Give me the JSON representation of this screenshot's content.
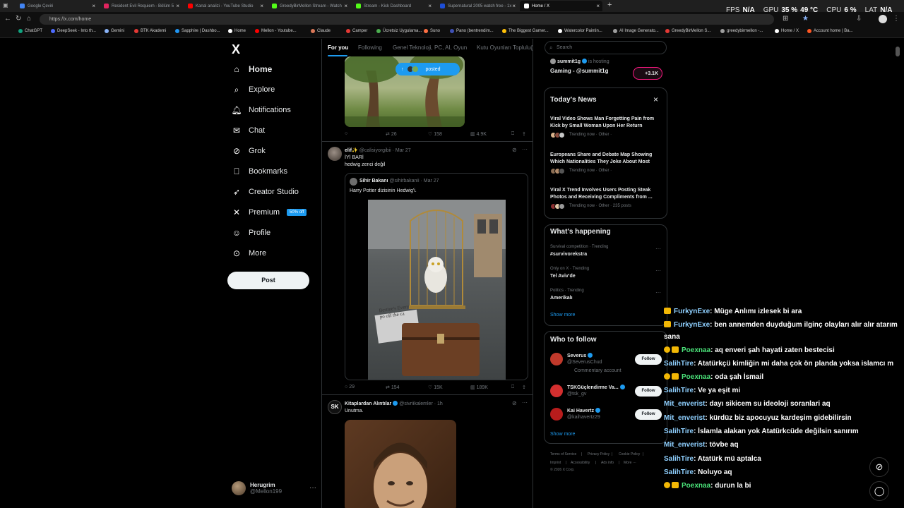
{
  "browser": {
    "tabs": [
      {
        "title": "Google Çeviri",
        "color": "#4285f4"
      },
      {
        "title": "Resident Evil Requiem - Bölüm 5",
        "color": "#e0245e"
      },
      {
        "title": "Kanal analizi - YouTube Studio",
        "color": "#ff0000"
      },
      {
        "title": "GreedyBirMellon Stream - Watch",
        "color": "#53fc18"
      },
      {
        "title": "Stream - Kick Dashboard",
        "color": "#53fc18"
      },
      {
        "title": "Supernatural 2005 watch free - 1x",
        "color": "#1d4ed8"
      },
      {
        "title": "Home / X",
        "color": "#ffffff"
      }
    ],
    "new_tab": "+",
    "url": "https://x.com/home",
    "bookmarks": [
      {
        "label": "ChatGPT",
        "color": "#10a37f"
      },
      {
        "label": "DeepSeek - Into th...",
        "color": "#4d6bfe"
      },
      {
        "label": "Gemini",
        "color": "#8ab4f8"
      },
      {
        "label": "BTK Akademi",
        "color": "#e53935"
      },
      {
        "label": "Sapphire | Dashbo...",
        "color": "#2196f3"
      },
      {
        "label": "Home",
        "color": "#ffffff"
      },
      {
        "label": "Mellon - Youtube...",
        "color": "#ff0000"
      },
      {
        "label": "Claude",
        "color": "#d97757"
      },
      {
        "label": "Camper",
        "color": "#e53935"
      },
      {
        "label": "Ücretsiz Uygulama...",
        "color": "#4caf50"
      },
      {
        "label": "Suno",
        "color": "#ff7043"
      },
      {
        "label": "Pano (bentrendim...",
        "color": "#3f51b5"
      },
      {
        "label": "The Biggest Gamer...",
        "color": "#ffc107"
      },
      {
        "label": "Watercolor Paintin...",
        "color": "#ffffff"
      },
      {
        "label": "AI Image Generato...",
        "color": "#9e9e9e"
      },
      {
        "label": "GreedyBirMellon S...",
        "color": "#e53935"
      },
      {
        "label": "greedybirmellon -...",
        "color": "#9e9e9e"
      },
      {
        "label": "Home / X",
        "color": "#ffffff"
      },
      {
        "label": "Account home | Ba...",
        "color": "#ff5722"
      }
    ],
    "hud": {
      "fps_label": "FPS",
      "fps": "N/A",
      "gpu_label": "GPU",
      "gpu": "35 %",
      "gpu_temp": "49 °C",
      "cpu_label": "CPU",
      "cpu": "6 %",
      "lat_label": "LAT",
      "lat": "N/A"
    }
  },
  "nav": {
    "logo": "X",
    "items": [
      {
        "label": "Home",
        "icon": "home-icon"
      },
      {
        "label": "Explore",
        "icon": "search-icon"
      },
      {
        "label": "Notifications",
        "icon": "bell-icon"
      },
      {
        "label": "Chat",
        "icon": "mail-icon"
      },
      {
        "label": "Grok",
        "icon": "grok-icon"
      },
      {
        "label": "Bookmarks",
        "icon": "bookmark-icon"
      },
      {
        "label": "Creator Studio",
        "icon": "rocket-icon"
      },
      {
        "label": "Premium",
        "icon": "x-icon"
      },
      {
        "label": "Profile",
        "icon": "person-icon"
      },
      {
        "label": "More",
        "icon": "more-circle-icon"
      }
    ],
    "premium_badge": "50% off",
    "post_button": "Post",
    "account": {
      "name": "Herugrim",
      "handle": "@Mellon199",
      "more": "···"
    }
  },
  "feed": {
    "tabs": [
      "For you",
      "Following",
      "Genel Teknoloji, PC, AI, Oyun",
      "Kutu Oyunları Topluluğ"
    ],
    "posted_pill": {
      "arrow": "↑",
      "label": "posted"
    },
    "tweet0_actions": {
      "replies": "",
      "retweets": "26",
      "likes": "158",
      "views": "4.9K"
    },
    "tweet1": {
      "author": "elif✨",
      "handle": "@calisiyorgibii",
      "date": "· Mar 27",
      "text1": "İYİ BARİ",
      "text2": "hedwig zenci değil",
      "quote": {
        "author": "Sihir Bakanı",
        "handle": "@sihirbakanii",
        "date": "· Mar 27",
        "text": "Harry Potter dizisinin Hedwig'i.",
        "sign_text": "Bertine's Every po off the ca"
      },
      "actions": {
        "replies": "29",
        "retweets": "154",
        "likes": "15K",
        "views": "189K"
      }
    },
    "tweet2": {
      "author": "Kitaplardan Alıntılar",
      "handle": "@sivriikalemler",
      "date": "· 1h",
      "text": "Unutma.",
      "avatar_text": "SK"
    }
  },
  "right": {
    "search_placeholder": "Search",
    "live": {
      "host": "summit1g",
      "hosting": "is hosting",
      "title": "Gaming - @summit1g",
      "count": "+3.1K"
    },
    "todays_news": {
      "title": "Today's News",
      "close": "×",
      "items": [
        {
          "title": "Viral Video Shows Man Forgetting Pain from Kick by Small Woman Upon Her Return",
          "meta": "Trending now · Other ·"
        },
        {
          "title": "Europeans Share and Debate Map Showing Which Nationalities They Joke About Most",
          "meta": "Trending now · Other ·"
        },
        {
          "title": "Viral X Trend Involves Users Posting Steak Photos and Receiving Compliments from ...",
          "meta": "Trending now · Other · 235 posts"
        }
      ]
    },
    "happening": {
      "title": "What's happening",
      "items": [
        {
          "meta": "Survival competition · Trending",
          "name": "#survivorekstra"
        },
        {
          "meta": "Only on X · Trending",
          "name": "Tel Aviv'de"
        },
        {
          "meta": "Politics · Trending",
          "name": "Amerikalı"
        }
      ],
      "show_more": "Show more"
    },
    "who_to_follow": {
      "title": "Who to follow",
      "items": [
        {
          "name": "Severus",
          "handle": "@SeverusChud",
          "extra": "Commentary account",
          "color": "#c0392b"
        },
        {
          "name": "TSKGüçlendirme Va...",
          "handle": "@tsk_gv",
          "extra": "",
          "color": "#d32f2f"
        },
        {
          "name": "Kai Havertz",
          "handle": "@kaihavertz29",
          "extra": "",
          "color": "#b71c1c"
        }
      ],
      "follow": "Follow",
      "show_more": "Show more"
    },
    "footer": [
      "Terms of Service",
      "|",
      "Privacy Policy",
      "|",
      "Cookie Policy",
      "|",
      "Imprint",
      "|",
      "Accessibility",
      "|",
      "Ads info",
      "|",
      "More ···",
      "© 2026 X Corp."
    ]
  },
  "chat": [
    {
      "user": "FurkynExe",
      "msg": ": Müge Anlımı izlesek bi ara",
      "style": "blue",
      "badge": "crown"
    },
    {
      "user": "FurkynExe",
      "msg": ": ben annemden duyduğum ilginç olayları alır alır atarım",
      "style": "blue",
      "badge": "crown"
    },
    {
      "user": "",
      "msg": "sana",
      "style": "cont",
      "badge": ""
    },
    {
      "user": "Poexnaa",
      "msg": ": aq enveri şah hayati zaten bestecisi",
      "style": "green",
      "badge": "two"
    },
    {
      "user": "SalihTire",
      "msg": ": Atatürkçü kimliğin mi daha çok ön planda yoksa islamcı m",
      "style": "blue",
      "badge": ""
    },
    {
      "user": "Poexnaa",
      "msg": ": oda şah İsmail",
      "style": "green",
      "badge": "two"
    },
    {
      "user": "SalihTire",
      "msg": ": Ve ya eşit mi",
      "style": "blue",
      "badge": ""
    },
    {
      "user": "Mit_enverist",
      "msg": ": dayı sikicem su ideoloji soranlari aq",
      "style": "blue",
      "badge": ""
    },
    {
      "user": "Mit_enverist",
      "msg": ": kürdüz biz apocuyuz kardeşim gidebilirsin",
      "style": "blue",
      "badge": ""
    },
    {
      "user": "SalihTire",
      "msg": ": İslamla alakan yok Atatürkcüde değilsin sanırım",
      "style": "blue",
      "badge": ""
    },
    {
      "user": "Mit_enverist",
      "msg": ": tövbe aq",
      "style": "blue",
      "badge": ""
    },
    {
      "user": "SalihTire",
      "msg": ": Atatürk mü aptalca",
      "style": "blue",
      "badge": ""
    },
    {
      "user": "SalihTire",
      "msg": ": Noluyo aq",
      "style": "blue",
      "badge": ""
    },
    {
      "user": "Poexnaa",
      "msg": ": durun la bi",
      "style": "green",
      "badge": "two"
    }
  ]
}
